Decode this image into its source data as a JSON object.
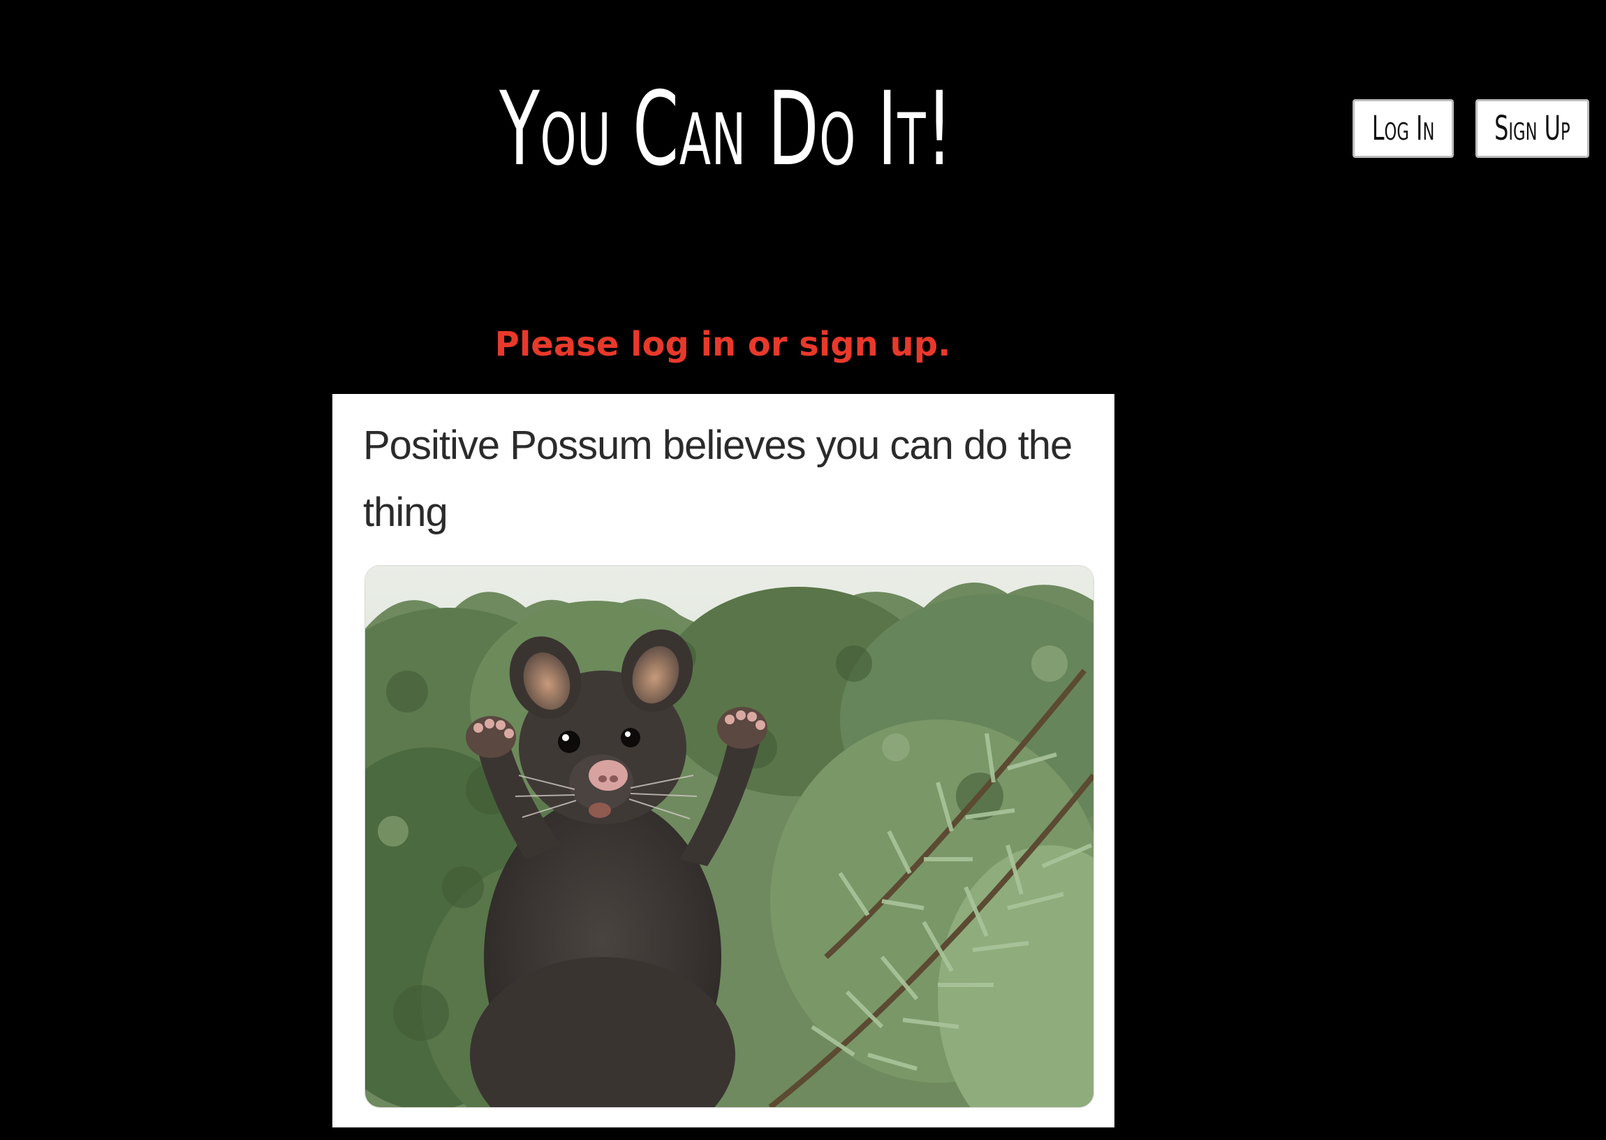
{
  "header": {
    "title": "You Can Do It!",
    "login_label": "Log In",
    "signup_label": "Sign Up"
  },
  "main": {
    "notice": "Please log in or sign up.",
    "meme": {
      "caption": "Positive Possum believes you can do the thing"
    }
  },
  "colors": {
    "background": "#000000",
    "title": "#ffffff",
    "notice": "#e8392b",
    "button_bg": "#ffffff"
  },
  "icons": {
    "meme_image": "possum-photo-icon"
  }
}
